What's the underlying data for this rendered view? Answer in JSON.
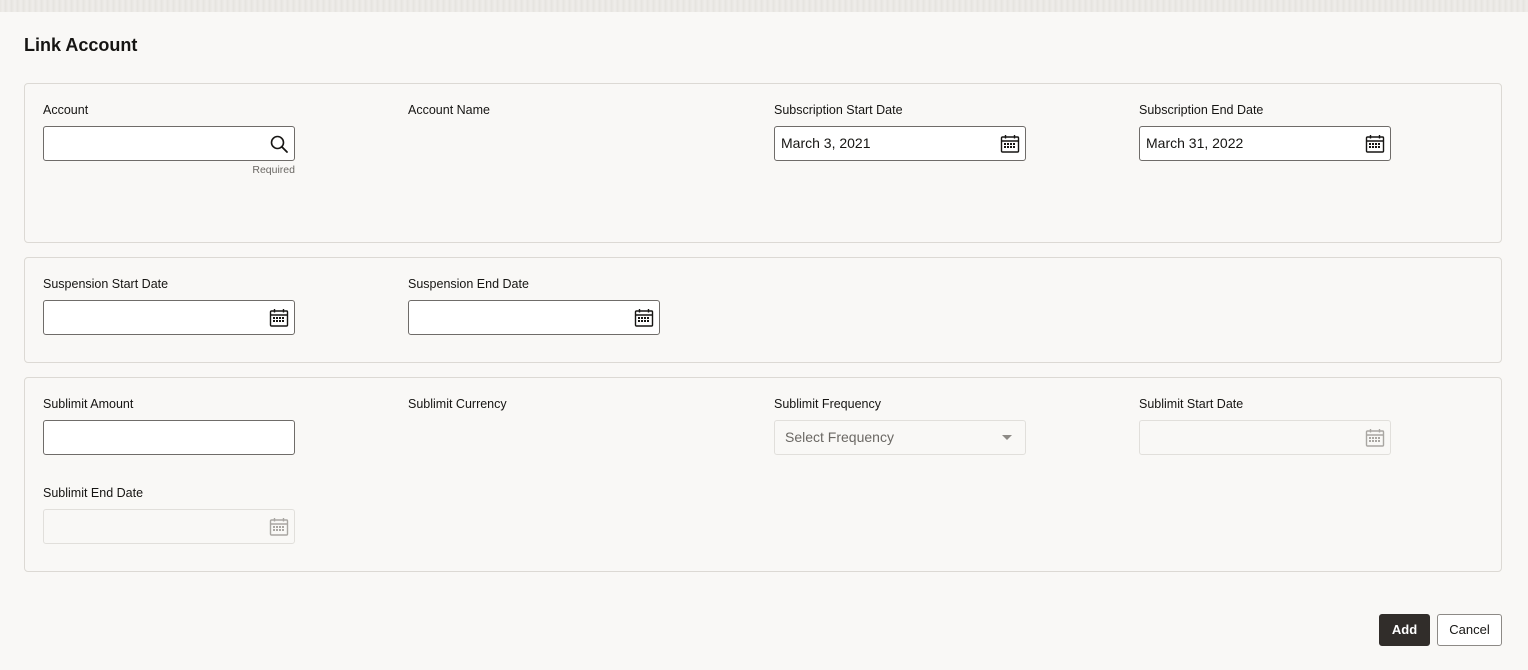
{
  "page": {
    "title": "Link Account"
  },
  "account_section": {
    "account": {
      "label": "Account",
      "value": "",
      "hint": "Required",
      "icon": "search-icon"
    },
    "account_name": {
      "label": "Account Name"
    },
    "subscription_start_date": {
      "label": "Subscription Start Date",
      "value": "March 3, 2021",
      "icon": "calendar-icon"
    },
    "subscription_end_date": {
      "label": "Subscription End Date",
      "value": "March 31, 2022",
      "icon": "calendar-icon"
    }
  },
  "suspension_section": {
    "suspension_start_date": {
      "label": "Suspension Start Date",
      "value": "",
      "icon": "calendar-icon"
    },
    "suspension_end_date": {
      "label": "Suspension End Date",
      "value": "",
      "icon": "calendar-icon"
    }
  },
  "sublimit_section": {
    "sublimit_amount": {
      "label": "Sublimit Amount",
      "value": ""
    },
    "sublimit_currency": {
      "label": "Sublimit Currency"
    },
    "sublimit_frequency": {
      "label": "Sublimit Frequency",
      "placeholder": "Select Frequency"
    },
    "sublimit_start_date": {
      "label": "Sublimit Start Date",
      "value": "",
      "icon": "calendar-icon"
    },
    "sublimit_end_date": {
      "label": "Sublimit End Date",
      "value": "",
      "icon": "calendar-icon"
    }
  },
  "actions": {
    "add_label": "Add",
    "cancel_label": "Cancel"
  },
  "colors": {
    "primary_button": "#312d2a",
    "background": "#f9f8f6",
    "border": "#dcd9d4"
  }
}
